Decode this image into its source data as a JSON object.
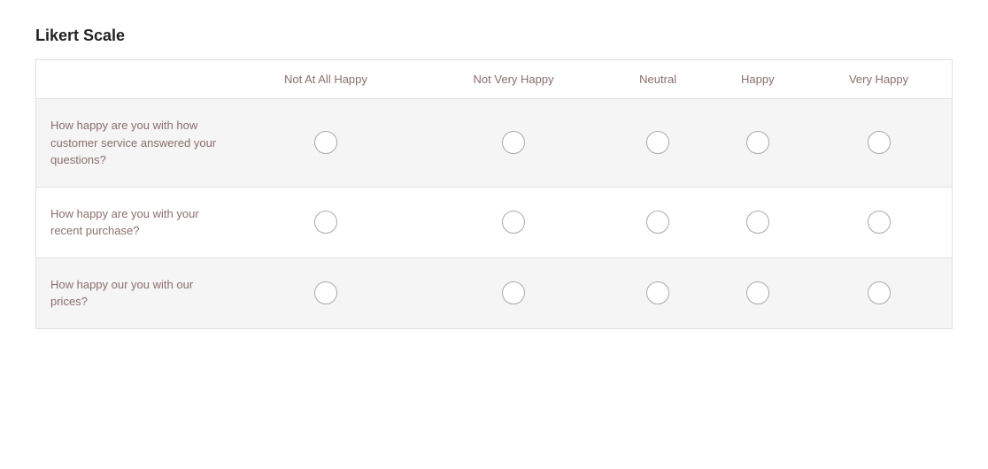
{
  "title": "Likert Scale",
  "columns": {
    "question": "",
    "not_at_all_happy": "Not At All Happy",
    "not_very_happy": "Not Very Happy",
    "neutral": "Neutral",
    "happy": "Happy",
    "very_happy": "Very Happy"
  },
  "rows": [
    {
      "question": "How happy are you with how customer service answered your questions?"
    },
    {
      "question": "How happy are you with your recent purchase?"
    },
    {
      "question": "How happy our you with our prices?"
    }
  ]
}
